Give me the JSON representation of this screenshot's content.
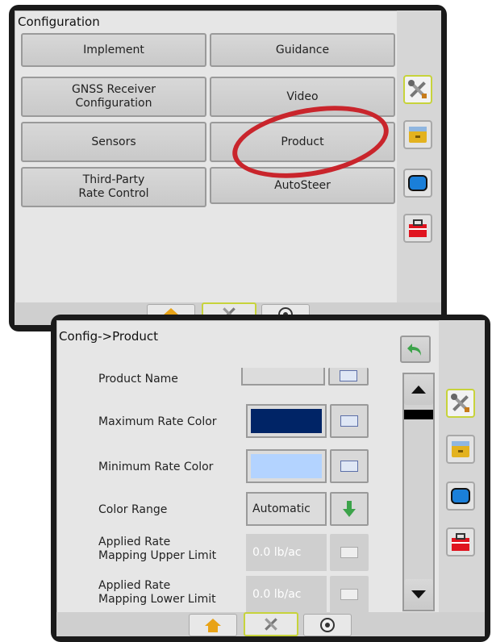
{
  "config_screen": {
    "title": "Configuration",
    "buttons": {
      "implement": "Implement",
      "guidance": "Guidance",
      "gnss": "GNSS Receiver\nConfiguration",
      "video": "Video",
      "sensors": "Sensors",
      "product": "Product",
      "third_party": "Third-Party\nRate Control",
      "autosteer": "AutoSteer"
    }
  },
  "product_screen": {
    "title": "Config->Product",
    "rows": {
      "product_name": "Product Name",
      "max_rate_color": "Maximum Rate Color",
      "min_rate_color": "Minimum Rate Color",
      "color_range": "Color Range",
      "color_range_value": "Automatic",
      "upper_limit": "Applied Rate\nMapping Upper Limit",
      "upper_value": "0.0 lb/ac",
      "lower_limit": "Applied Rate\nMapping Lower Limit",
      "lower_value": "0.0 lb/ac"
    }
  },
  "colors": {
    "max_rate_color": "#002466",
    "min_rate_color": "#b3d3ff",
    "highlight": "#c9252c",
    "active_tab": "#c7d33b"
  },
  "icons": {
    "sidebar": [
      "tools-icon",
      "file-cabinet-icon",
      "monitor-icon",
      "toolbox-icon"
    ],
    "tabs": [
      "home-icon",
      "tools-icon",
      "gauge-icon"
    ],
    "back": "back-arrow-icon",
    "down": "down-arrow-icon"
  }
}
